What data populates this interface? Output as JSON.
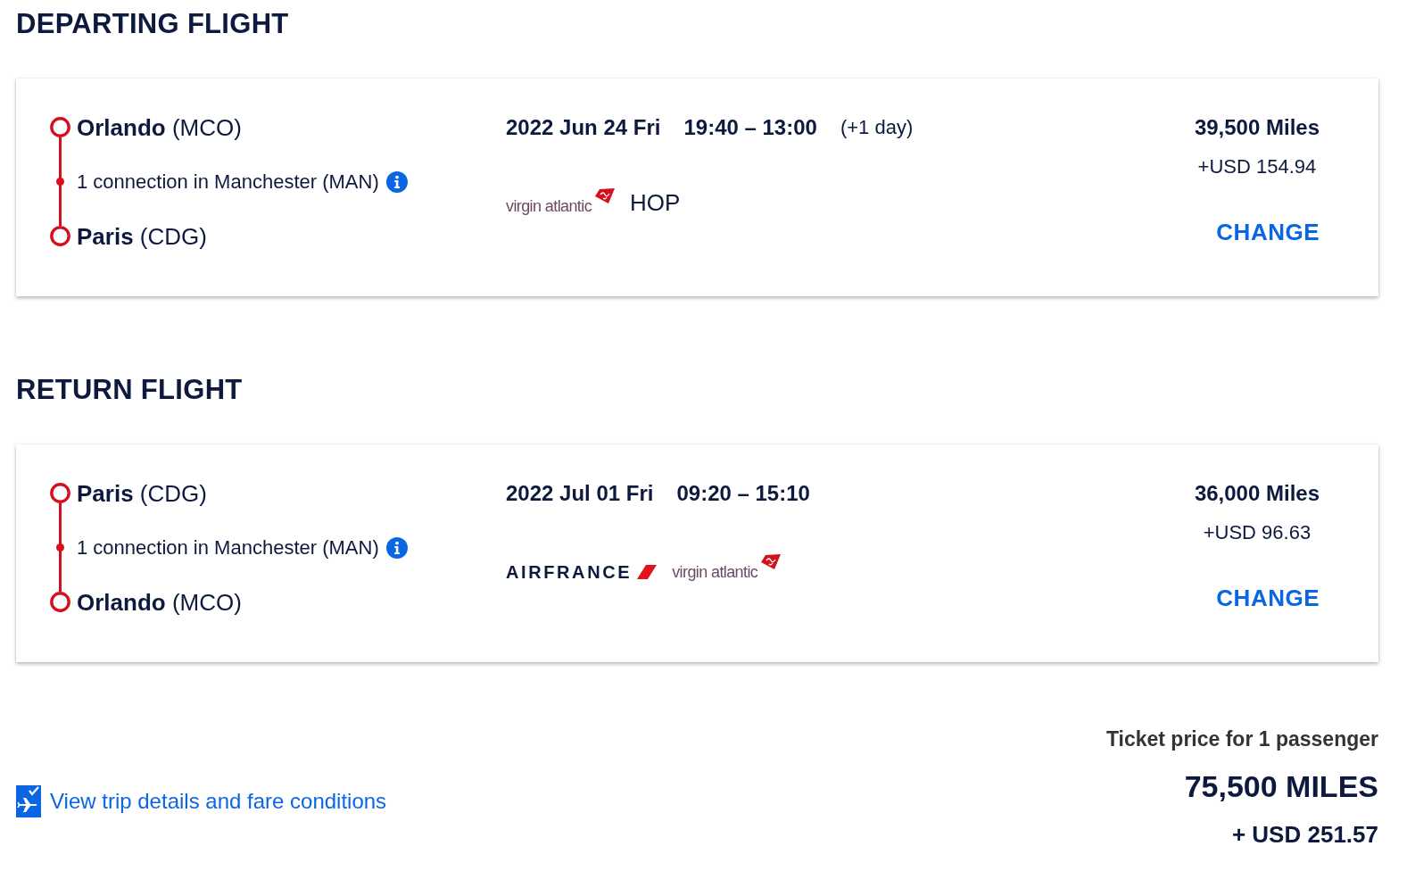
{
  "sections": [
    {
      "heading": "DEPARTING FLIGHT",
      "stops": [
        {
          "kind": "endpoint",
          "label": "**Orlando** (MCO)"
        },
        {
          "kind": "connection",
          "label": "1 connection in Manchester (MAN)"
        },
        {
          "kind": "endpoint",
          "label": "**Paris** (CDG)"
        }
      ],
      "date": "2022 Jun 24 Fri",
      "times": "19:40 – 13:00",
      "day_offset": "(+1 day)",
      "carriers": [
        {
          "kind": "virgin",
          "name": "virgin atlantic"
        },
        {
          "kind": "plain",
          "name": "HOP"
        }
      ],
      "miles": "39,500 Miles",
      "surcharge": "+USD 154.94",
      "change_button": "CHANGE"
    },
    {
      "heading": "RETURN FLIGHT",
      "stops": [
        {
          "kind": "endpoint",
          "label": "**Paris** (CDG)"
        },
        {
          "kind": "connection",
          "label": "1 connection in Manchester (MAN)"
        },
        {
          "kind": "endpoint",
          "label": "**Orlando** (MCO)"
        }
      ],
      "date": "2022 Jul 01 Fri",
      "times": "09:20 – 15:10",
      "carriers": [
        {
          "kind": "airfrance",
          "name": "AIRFRANCE"
        },
        {
          "kind": "virgin",
          "name": "virgin atlantic"
        }
      ],
      "miles": "36,000 Miles",
      "surcharge": "+USD 96.63",
      "change_button": "CHANGE"
    }
  ],
  "footer": {
    "link": "View trip details and fare conditions",
    "price_label": "Ticket price for 1 passenger",
    "total_miles": "75,500 MILES",
    "total_cash": "+ USD 251.57"
  }
}
